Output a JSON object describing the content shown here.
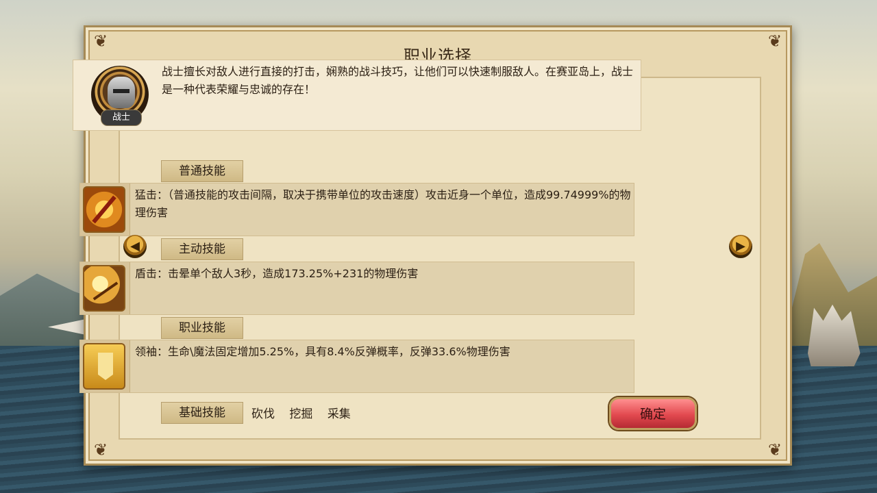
{
  "dialog": {
    "title": "职业选择",
    "class_name": "战士",
    "description": "战士擅长对敌人进行直接的打击，娴熟的战斗技巧，让他们可以快速制服敌人。在赛亚岛上，战士是一种代表荣耀与忠诚的存在！"
  },
  "sections": {
    "normal": {
      "label": "普通技能",
      "text": "猛击：（普通技能的攻击间隔，取决于携带单位的攻击速度）攻击近身一个单位，造成99.74999%的物理伤害"
    },
    "active": {
      "label": "主动技能",
      "text": "盾击：击晕单个敌人3秒，造成173.25%+231的物理伤害"
    },
    "class": {
      "label": "职业技能",
      "text": "领袖：生命\\魔法固定增加5.25%，具有8.4%反弹概率，反弹33.6%物理伤害"
    },
    "basic": {
      "label": "基础技能",
      "items": [
        "砍伐",
        "挖掘",
        "采集"
      ]
    }
  },
  "buttons": {
    "confirm": "确定"
  },
  "icons": {
    "left_arrow": "arrow-left-icon",
    "right_arrow": "arrow-right-icon"
  }
}
